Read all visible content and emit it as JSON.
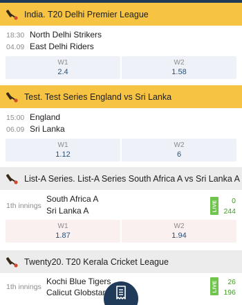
{
  "sections": [
    {
      "league": "India. T20 Delhi Premier League",
      "time": "18:30",
      "date": "04.09",
      "team1": "North Delhi Strikers",
      "team2": "East Delhi Riders",
      "odds": [
        {
          "label": "W1",
          "value": "2.4"
        },
        {
          "label": "W2",
          "value": "1.58"
        }
      ]
    },
    {
      "league": "Test. Test Series England vs Sri Lanka",
      "time": "15:00",
      "date": "06.09",
      "team1": "England",
      "team2": "Sri Lanka",
      "odds": [
        {
          "label": "W1",
          "value": "1.12"
        },
        {
          "label": "W2",
          "value": "6"
        }
      ]
    },
    {
      "league": "List-A Series. List-A Series South Africa A vs Sri Lanka A",
      "innings": "1th innings",
      "team1": "South Africa A",
      "team2": "Sri Lanka A",
      "live": "LIVE",
      "score1": "0",
      "score2": "244",
      "odds": [
        {
          "label": "W1",
          "value": "1.87"
        },
        {
          "label": "W2",
          "value": "1.94"
        }
      ]
    },
    {
      "league": "Twenty20. T20 Kerala Cricket League",
      "innings": "1th innings",
      "team1": "Kochi Blue Tigers",
      "team2": "Calicut Globstars",
      "live": "LIVE",
      "score1": "26",
      "score2": "196"
    }
  ],
  "icons": {
    "league": "cricket-bat-icon",
    "fab": "bet-slip-icon"
  },
  "colors": {
    "header_yellow": "#f6c343",
    "header_grey": "#ececec",
    "odds_value": "#2a4f76",
    "live_green": "#6fc54b",
    "score_green": "#3f9e21",
    "fab_navy": "#1f3b59"
  }
}
